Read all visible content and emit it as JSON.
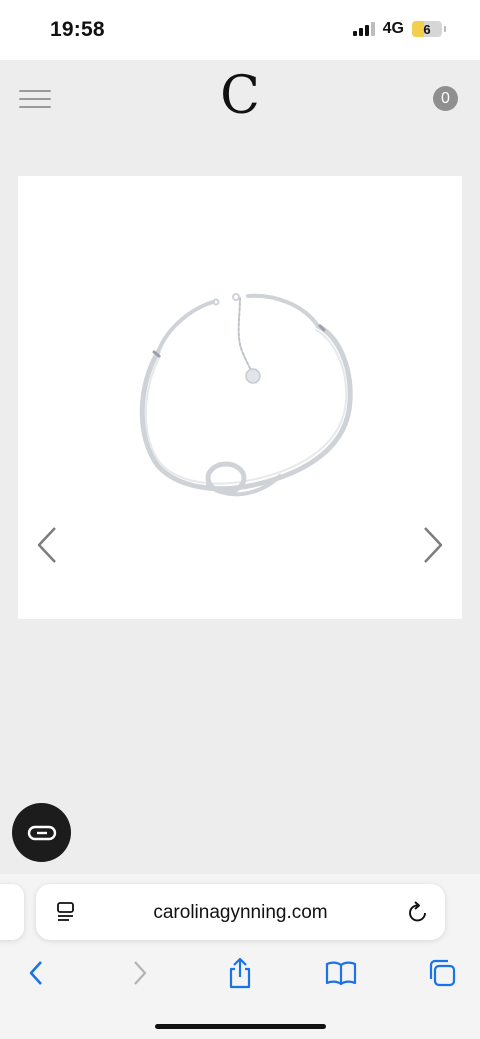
{
  "status_bar": {
    "time": "19:58",
    "network": "4G",
    "battery_level": "6"
  },
  "header": {
    "logo": "C",
    "cart_count": "0"
  },
  "browser": {
    "url": "carolinagynning.com"
  },
  "colors": {
    "page_background": "#ededed",
    "accent_blue": "#1a73e8",
    "disabled_gray": "#b3b3b3"
  },
  "icons": {
    "menu": "menu-icon",
    "prev": "chevron-left-icon",
    "next": "chevron-right-icon",
    "chat": "chat-icon",
    "share": "share-icon",
    "bookmarks": "book-icon",
    "tabs": "tabs-icon",
    "reload": "reload-icon",
    "page": "page-menu-icon"
  }
}
